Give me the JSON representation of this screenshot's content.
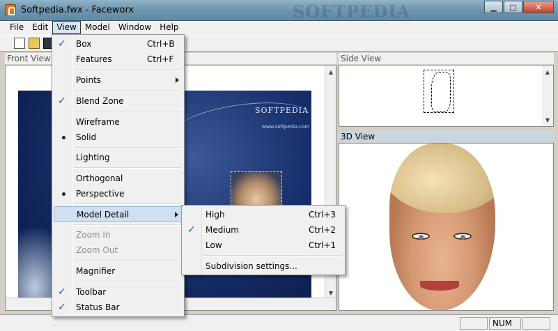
{
  "window": {
    "title": "Softpedia.fwx - Faceworx",
    "watermark": "SOFTPEDIA",
    "minimize": "▁",
    "maximize": "□",
    "close": "✕"
  },
  "menubar": [
    "File",
    "Edit",
    "View",
    "Model",
    "Window",
    "Help"
  ],
  "panes": {
    "front_title": "Front View",
    "side_title": "Side View",
    "three_d_title": "3D View",
    "front_logo": "SOFTPEDIA",
    "front_url": "www.softpedia.com"
  },
  "view_menu": {
    "box": {
      "label": "Box",
      "shortcut": "Ctrl+B"
    },
    "features": {
      "label": "Features",
      "shortcut": "Ctrl+F"
    },
    "points": {
      "label": "Points"
    },
    "blend_zone": {
      "label": "Blend Zone"
    },
    "wireframe": {
      "label": "Wireframe"
    },
    "solid": {
      "label": "Solid"
    },
    "lighting": {
      "label": "Lighting"
    },
    "orthogonal": {
      "label": "Orthogonal"
    },
    "perspective": {
      "label": "Perspective"
    },
    "model_detail": {
      "label": "Model Detail"
    },
    "zoom_in": {
      "label": "Zoom In"
    },
    "zoom_out": {
      "label": "Zoom Out"
    },
    "magnifier": {
      "label": "Magnifier"
    },
    "toolbar": {
      "label": "Toolbar"
    },
    "status_bar": {
      "label": "Status Bar"
    }
  },
  "model_detail_menu": {
    "high": {
      "label": "High",
      "shortcut": "Ctrl+3"
    },
    "medium": {
      "label": "Medium",
      "shortcut": "Ctrl+2"
    },
    "low": {
      "label": "Low",
      "shortcut": "Ctrl+1"
    },
    "subdivision": {
      "label": "Subdivision settings..."
    }
  },
  "statusbar": {
    "num": "NUM"
  },
  "glyphs": {
    "check": "✓"
  }
}
